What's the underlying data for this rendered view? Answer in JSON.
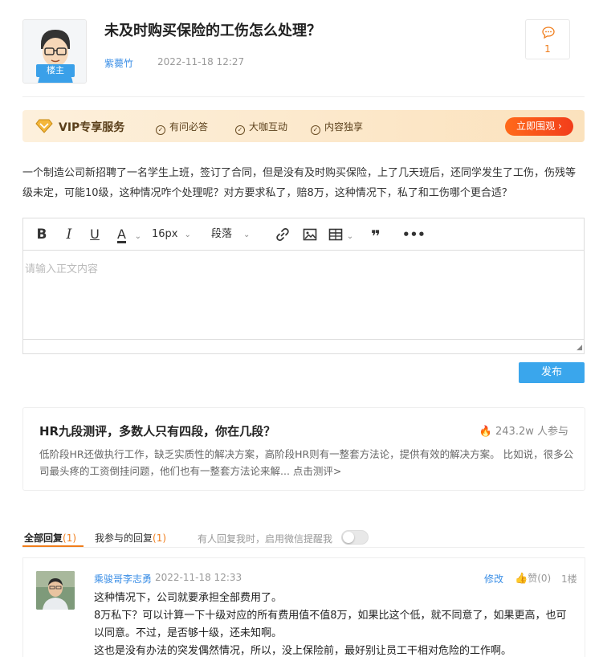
{
  "post": {
    "title": "未及时购买保险的工伤怎么处理？",
    "author": "紫薨竹",
    "date": "2022-11-18 12:27",
    "owner_badge": "楼主",
    "comment_count": "1",
    "icons": {
      "comment": "comment-bubble-icon"
    },
    "body": "一个制造公司新招聘了一名学生上班，签订了合同，但是没有及时购买保险，上了几天班后，还同学发生了工伤，伤残等级未定，可能10级，这种情况咋个处理呢？对方要求私了，赔8万，这种情况下，私了和工伤哪个更合适？"
  },
  "vip": {
    "title": "VIP专享服务",
    "items": [
      "有问必答",
      "大咖互动",
      "内容独享"
    ],
    "button": "立即围观"
  },
  "editor": {
    "font_size": "16px",
    "paragraph": "段落",
    "placeholder": "请输入正文内容",
    "publish": "发布"
  },
  "promo": {
    "title": "HR九段测评，多数人只有四段，你在几段？",
    "stat": "243.2w 人参与",
    "desc": "低阶段HR还做执行工作，缺乏实质性的解决方案，高阶段HR则有一整套方法论，提供有效的解决方案。 比如说，很多公司最头疼的工资倒挂问题，他们也有一整套方法论来解... 点击测评>"
  },
  "tabs": {
    "all_label": "全部回复",
    "all_count": "(1)",
    "mine_label": "我参与的回复",
    "mine_count": "(1)",
    "notify": "有人回复我时，启用微信提醒我"
  },
  "reply": {
    "name": "乘骏哥李志勇",
    "date": "2022-11-18 12:33",
    "edit": "修改",
    "like": "赞(0)",
    "floor": "1楼",
    "lines": [
      "这种情况下，公司就要承担全部费用了。",
      "8万私下？可以计算一下十级对应的所有费用值不值8万，如果比这个低，就不同意了，如果更高，也可以同意。不过，是否够十级，还未知啊。",
      "这也是没有办法的突发偶然情况，所以，没上保险前，最好别让员工干相对危险的工作啊。"
    ]
  },
  "colors": {
    "accent_blue": "#3a8ee6",
    "accent_orange": "#f07d1b",
    "vip_button": "#f23d1b"
  }
}
